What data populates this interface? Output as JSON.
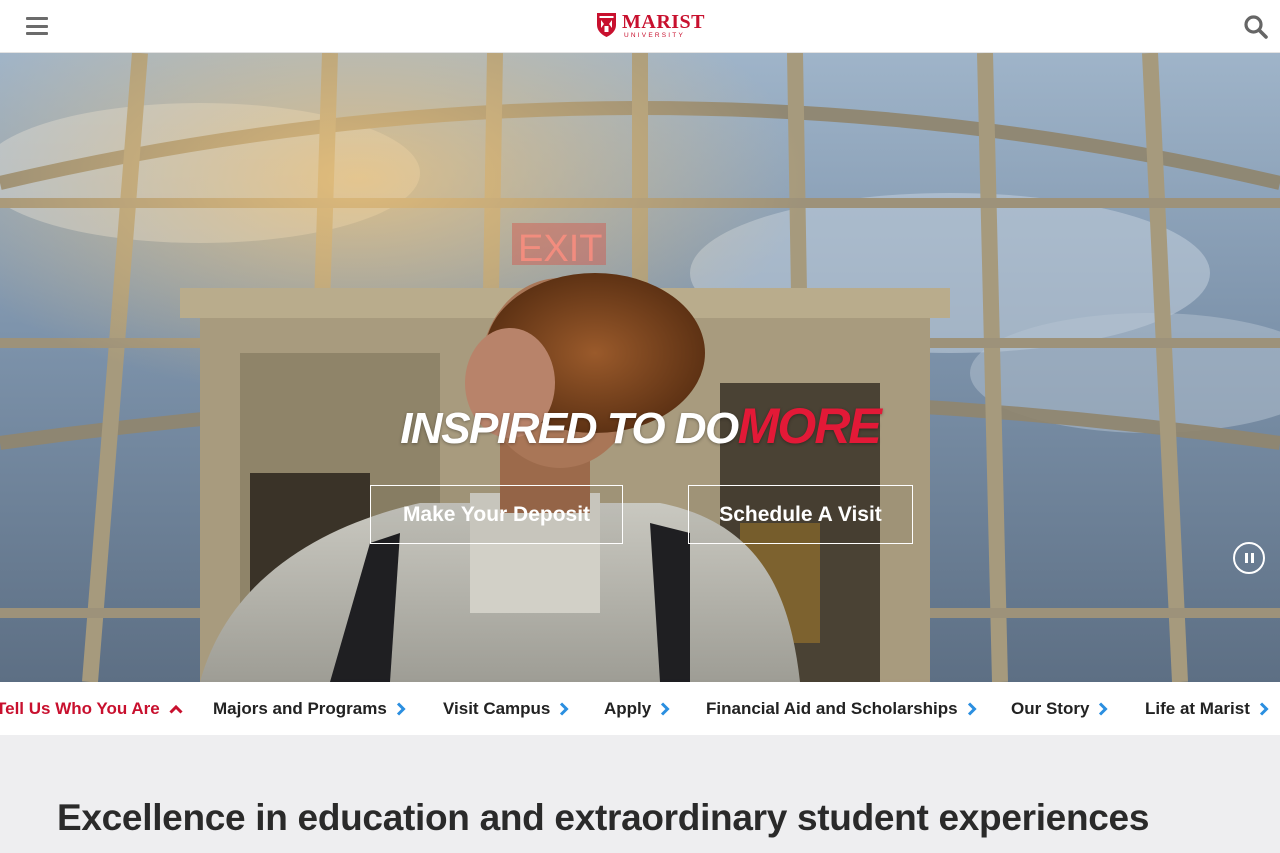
{
  "header": {
    "logo_word": "MARIST",
    "logo_sub": "UNIVERSITY",
    "menu_icon": "hamburger-menu-icon",
    "search_icon": "search-icon",
    "brand_color": "#c8102e"
  },
  "hero": {
    "title_main": "INSPIRED TO DO",
    "title_accent": "MORE",
    "buttons": {
      "deposit": "Make Your Deposit",
      "visit": "Schedule A Visit"
    },
    "pause_icon": "pause-icon"
  },
  "nav": {
    "items": [
      {
        "label": "Tell Us Who You Are",
        "icon": "chevron-up-icon",
        "active": true
      },
      {
        "label": "Majors and Programs",
        "icon": "chevron-right-icon"
      },
      {
        "label": "Visit Campus",
        "icon": "chevron-right-icon"
      },
      {
        "label": "Apply",
        "icon": "chevron-right-icon"
      },
      {
        "label": "Financial Aid and Scholarships",
        "icon": "chevron-right-icon"
      },
      {
        "label": "Our Story",
        "icon": "chevron-right-icon"
      },
      {
        "label": "Life at Marist",
        "icon": "chevron-right-icon"
      }
    ],
    "chevron_color": "#2b8fe0",
    "active_color": "#c8102e"
  },
  "section": {
    "title": "Excellence in education and extraordinary student experiences"
  }
}
